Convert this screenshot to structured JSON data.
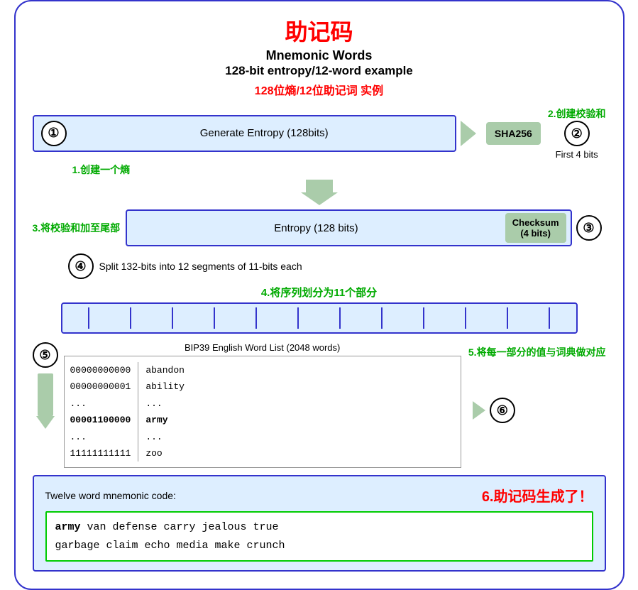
{
  "title": {
    "cn": "助记码",
    "en1": "Mnemonic Words",
    "en2": "128-bit entropy/12-word example",
    "subtitle_cn": "128位熵/12位助记词 实例"
  },
  "step1": {
    "label": "1.创建一个熵",
    "circle": "①",
    "box_text": "Generate Entropy (128bits)"
  },
  "step2": {
    "label": "2.创建校验和",
    "sha": "SHA256",
    "first4": "First 4 bits",
    "circle": "②"
  },
  "step3": {
    "label": "3.将校验和加至尾部",
    "entropy_text": "Entropy (128 bits)",
    "checksum_text": "Checksum\n(4 bits)",
    "circle": "③"
  },
  "step4": {
    "circle": "④",
    "split_text": "Split 132-bits into 12 segments of 11-bits each",
    "label_cn": "4.将序列划分为11个部分"
  },
  "bip39": {
    "label": "BIP39 English Word List (2048 words)",
    "col1": [
      "00000000000",
      "00000000001",
      "...",
      "00001100000",
      "...",
      "11111111111"
    ],
    "col2": [
      "abandon",
      "ability",
      "...",
      "army",
      "...",
      "zoo"
    ],
    "circle5": "⑤",
    "step5_label": "5.将每一部分的值与词典做对应"
  },
  "step6": {
    "circle": "⑥",
    "label": "6.助记码生成了！",
    "mnemonic_label": "Twelve word mnemonic code:",
    "mnemonic_words_line1": "army van defense carry jealous true",
    "mnemonic_words_line2": "garbage claim echo media make crunch",
    "mnemonic_first": "army"
  },
  "colors": {
    "blue_border": "#3333cc",
    "red": "#ff0000",
    "green": "#00aa00",
    "light_blue_bg": "#ddeeff",
    "green_arrow": "#aaccaa",
    "green_text": "#00cc00"
  }
}
